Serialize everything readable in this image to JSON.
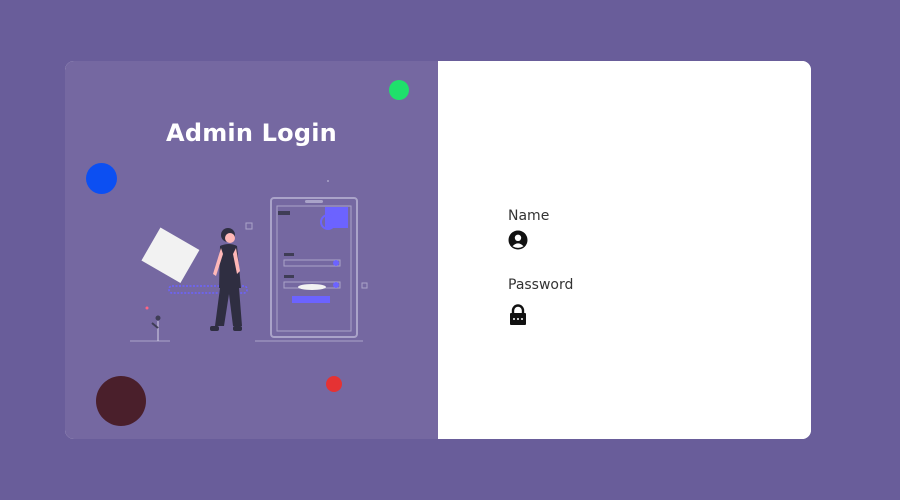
{
  "panel": {
    "title": "Admin Login"
  },
  "form": {
    "fields": [
      {
        "label": "Name",
        "icon": "user-circle-icon"
      },
      {
        "label": "Password",
        "icon": "lock-icon"
      }
    ]
  },
  "colors": {
    "background": "#695d9a",
    "left_panel": "#7568a1",
    "right_panel": "#ffffff",
    "accent": "#6c63ff",
    "dot_green": "#1fe06b",
    "dot_blue": "#0c4ff2",
    "dot_red": "#e53233",
    "dot_maroon": "#4a1f2b"
  }
}
